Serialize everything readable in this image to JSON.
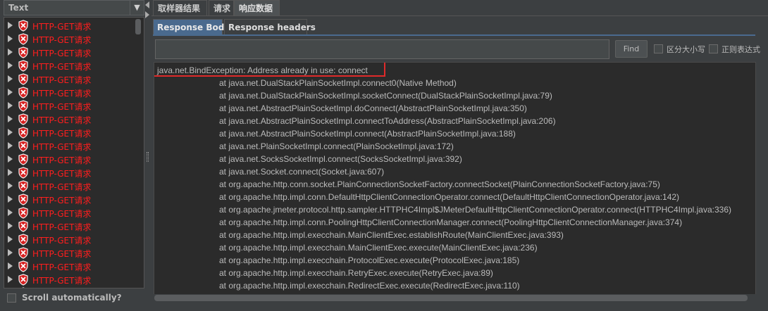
{
  "left_panel": {
    "renderer": "Text",
    "results": [
      "HTTP-GET请求",
      "HTTP-GET请求",
      "HTTP-GET请求",
      "HTTP-GET请求",
      "HTTP-GET请求",
      "HTTP-GET请求",
      "HTTP-GET请求",
      "HTTP-GET请求",
      "HTTP-GET请求",
      "HTTP-GET请求",
      "HTTP-GET请求",
      "HTTP-GET请求",
      "HTTP-GET请求",
      "HTTP-GET请求",
      "HTTP-GET请求",
      "HTTP-GET请求",
      "HTTP-GET请求",
      "HTTP-GET请求",
      "HTTP-GET请求",
      "HTTP-GET请求",
      "HTTP-GET请求"
    ],
    "scroll_automatically": "Scroll automatically?"
  },
  "tabs": [
    "取样器结果",
    "请求",
    "响应数据"
  ],
  "active_tab": "响应数据",
  "subtabs": [
    "Response Body",
    "Response headers"
  ],
  "active_subtab": "Response Body",
  "search": {
    "find_label": "Find",
    "case_sensitive": "区分大小写",
    "regex": "正则表达式"
  },
  "response_body": {
    "first_line": "java.net.BindException: Address already in use: connect",
    "trace": [
      "at java.net.DualStackPlainSocketImpl.connect0(Native Method)",
      "at java.net.DualStackPlainSocketImpl.socketConnect(DualStackPlainSocketImpl.java:79)",
      "at java.net.AbstractPlainSocketImpl.doConnect(AbstractPlainSocketImpl.java:350)",
      "at java.net.AbstractPlainSocketImpl.connectToAddress(AbstractPlainSocketImpl.java:206)",
      "at java.net.AbstractPlainSocketImpl.connect(AbstractPlainSocketImpl.java:188)",
      "at java.net.PlainSocketImpl.connect(PlainSocketImpl.java:172)",
      "at java.net.SocksSocketImpl.connect(SocksSocketImpl.java:392)",
      "at java.net.Socket.connect(Socket.java:607)",
      "at org.apache.http.conn.socket.PlainConnectionSocketFactory.connectSocket(PlainConnectionSocketFactory.java:75)",
      "at org.apache.http.impl.conn.DefaultHttpClientConnectionOperator.connect(DefaultHttpClientConnectionOperator.java:142)",
      "at org.apache.jmeter.protocol.http.sampler.HTTPHC4Impl$JMeterDefaultHttpClientConnectionOperator.connect(HTTPHC4Impl.java:336)",
      "at org.apache.http.impl.conn.PoolingHttpClientConnectionManager.connect(PoolingHttpClientConnectionManager.java:374)",
      "at org.apache.http.impl.execchain.MainClientExec.establishRoute(MainClientExec.java:393)",
      "at org.apache.http.impl.execchain.MainClientExec.execute(MainClientExec.java:236)",
      "at org.apache.http.impl.execchain.ProtocolExec.execute(ProtocolExec.java:185)",
      "at org.apache.http.impl.execchain.RetryExec.execute(RetryExec.java:89)",
      "at org.apache.http.impl.execchain.RedirectExec.execute(RedirectExec.java:110)"
    ]
  },
  "colors": {
    "error_text": "#ff1e1e",
    "highlight_border": "#e02a2a",
    "active_subtab": "#4a6a8e"
  },
  "icons": {
    "result_status": "error-shield-icon",
    "expand": "expand-triangle-icon",
    "dropdown": "chevron-down-icon"
  }
}
